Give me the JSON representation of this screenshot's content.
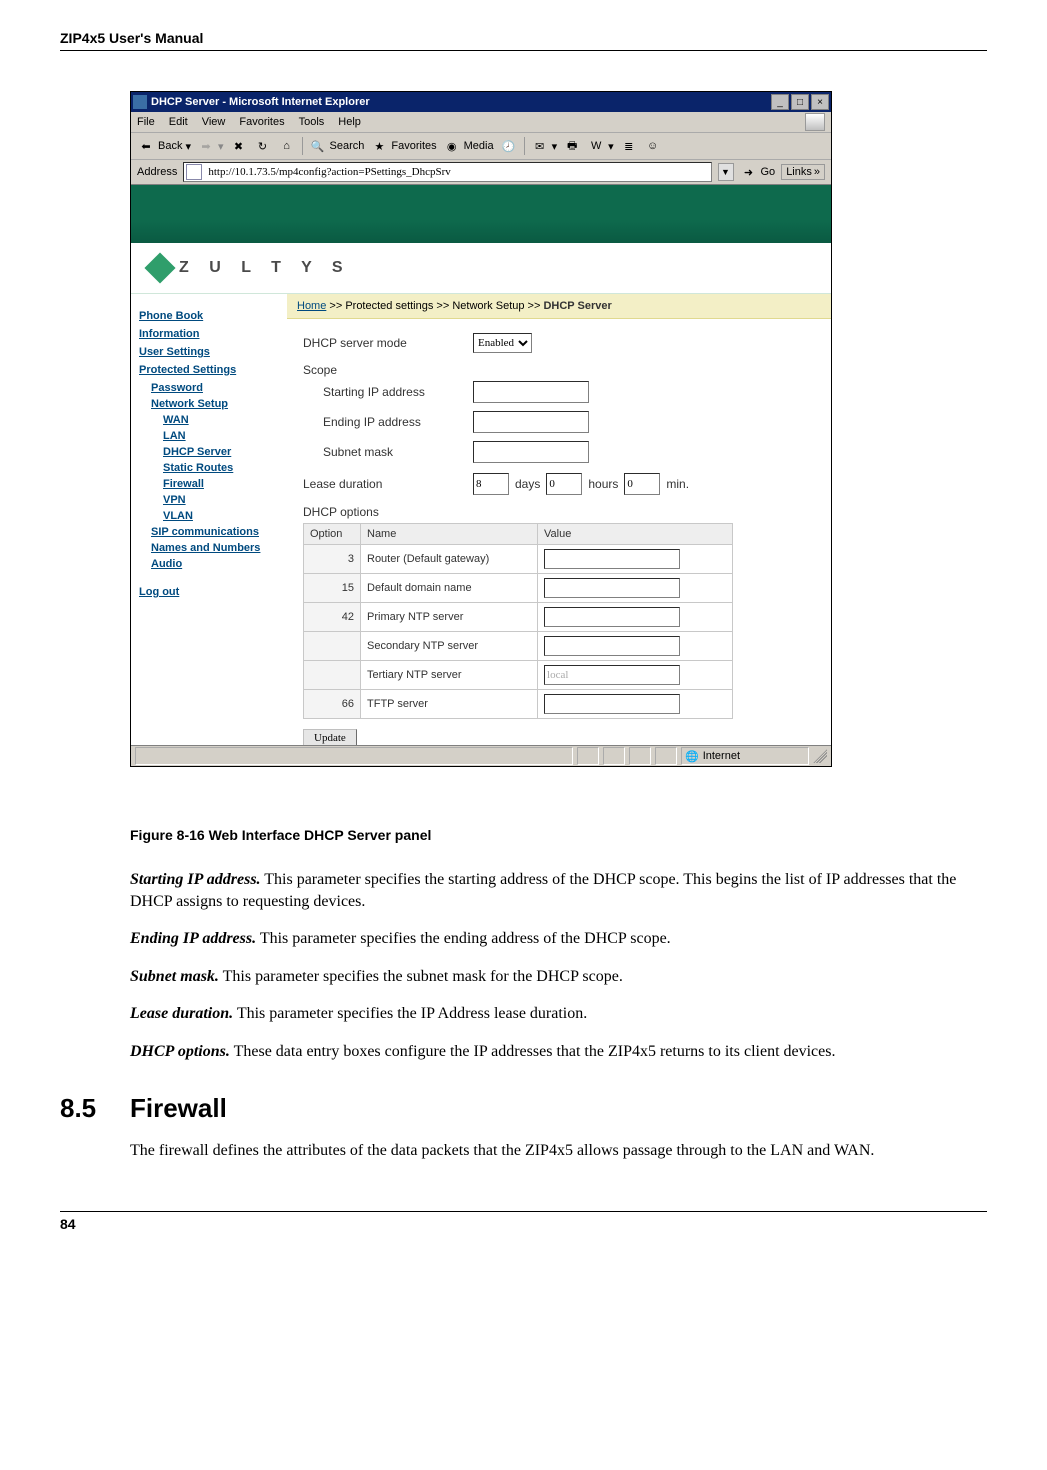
{
  "doc": {
    "running_head": "ZIP4x5 User's Manual",
    "figure_caption": "Figure 8-16     Web Interface DHCP Server panel",
    "para_start_label": "Starting IP address.",
    "para_start_text": " This parameter specifies the starting address of the DHCP scope. This begins the list of IP addresses that the DHCP assigns to requesting devices.",
    "para_end_label": "Ending IP address.",
    "para_end_text": " This parameter specifies the ending address of the DHCP scope.",
    "para_subnet_label": "Subnet mask.",
    "para_subnet_text": " This parameter specifies the subnet mask for the DHCP scope.",
    "para_lease_label": "Lease duration.",
    "para_lease_text": " This parameter specifies the IP Address lease duration.",
    "para_opts_label": "DHCP options.",
    "para_opts_text": " These data entry boxes configure the IP addresses that the ZIP4x5 returns to its client devices.",
    "section_num": "8.5",
    "section_title": "Firewall",
    "section_body": "The firewall defines the attributes of the data packets that the ZIP4x5 allows passage through to the LAN and WAN.",
    "page_number": "84"
  },
  "ie": {
    "title": "DHCP Server - Microsoft Internet Explorer",
    "win_min": "_",
    "win_max": "□",
    "win_close": "×",
    "menu": {
      "file": "File",
      "edit": "Edit",
      "view": "View",
      "favorites": "Favorites",
      "tools": "Tools",
      "help": "Help"
    },
    "toolbar": {
      "back": "Back",
      "forward": "",
      "stop": "",
      "refresh": "",
      "home": "",
      "search": "Search",
      "favorites": "Favorites",
      "media": "Media",
      "history": ""
    },
    "address_label": "Address",
    "address_value": "http://10.1.73.5/mp4config?action=PSettings_DhcpSrv",
    "go": "Go",
    "links": "Links",
    "status_left_icon": "e",
    "status_zone": "Internet"
  },
  "app": {
    "brand": "Z U L T Y S",
    "crumbs": {
      "home": "Home",
      "sep": " >> ",
      "p1": "Protected settings",
      "p2": "Network Setup",
      "current": "DHCP Server"
    },
    "sidebar": {
      "phone_book": "Phone Book",
      "information": "Information",
      "user_settings": "User Settings",
      "protected": "Protected Settings",
      "password": "Password",
      "network_setup": "Network Setup",
      "wan": "WAN",
      "lan": "LAN",
      "dhcp": "DHCP Server",
      "static": "Static Routes",
      "firewall": "Firewall",
      "vpn": "VPN",
      "vlan": "VLAN",
      "sip": "SIP communications",
      "names": "Names and Numbers",
      "audio": "Audio",
      "logout": "Log out"
    },
    "form": {
      "mode_label": "DHCP server mode",
      "mode_value": "Enabled",
      "scope_label": "Scope",
      "start_label": "Starting IP address",
      "end_label": "Ending IP address",
      "subnet_label": "Subnet mask",
      "start_value": "",
      "end_value": "",
      "subnet_value": "",
      "lease_label": "Lease duration",
      "lease_days": "8",
      "lease_hours": "0",
      "lease_mins": "0",
      "days_txt": "days",
      "hours_txt": "hours",
      "min_txt": "min.",
      "opts_label": "DHCP options",
      "th_option": "Option",
      "th_name": "Name",
      "th_value": "Value",
      "rows": [
        {
          "opt": "3",
          "name": "Router (Default gateway)",
          "val": ""
        },
        {
          "opt": "15",
          "name": "Default domain name",
          "val": ""
        },
        {
          "opt": "42",
          "name": "Primary NTP server",
          "val": ""
        },
        {
          "opt": "",
          "name": "Secondary NTP server",
          "val": ""
        },
        {
          "opt": "",
          "name": "Tertiary NTP server",
          "val": "local"
        },
        {
          "opt": "66",
          "name": "TFTP server",
          "val": ""
        }
      ],
      "update": "Update"
    }
  }
}
